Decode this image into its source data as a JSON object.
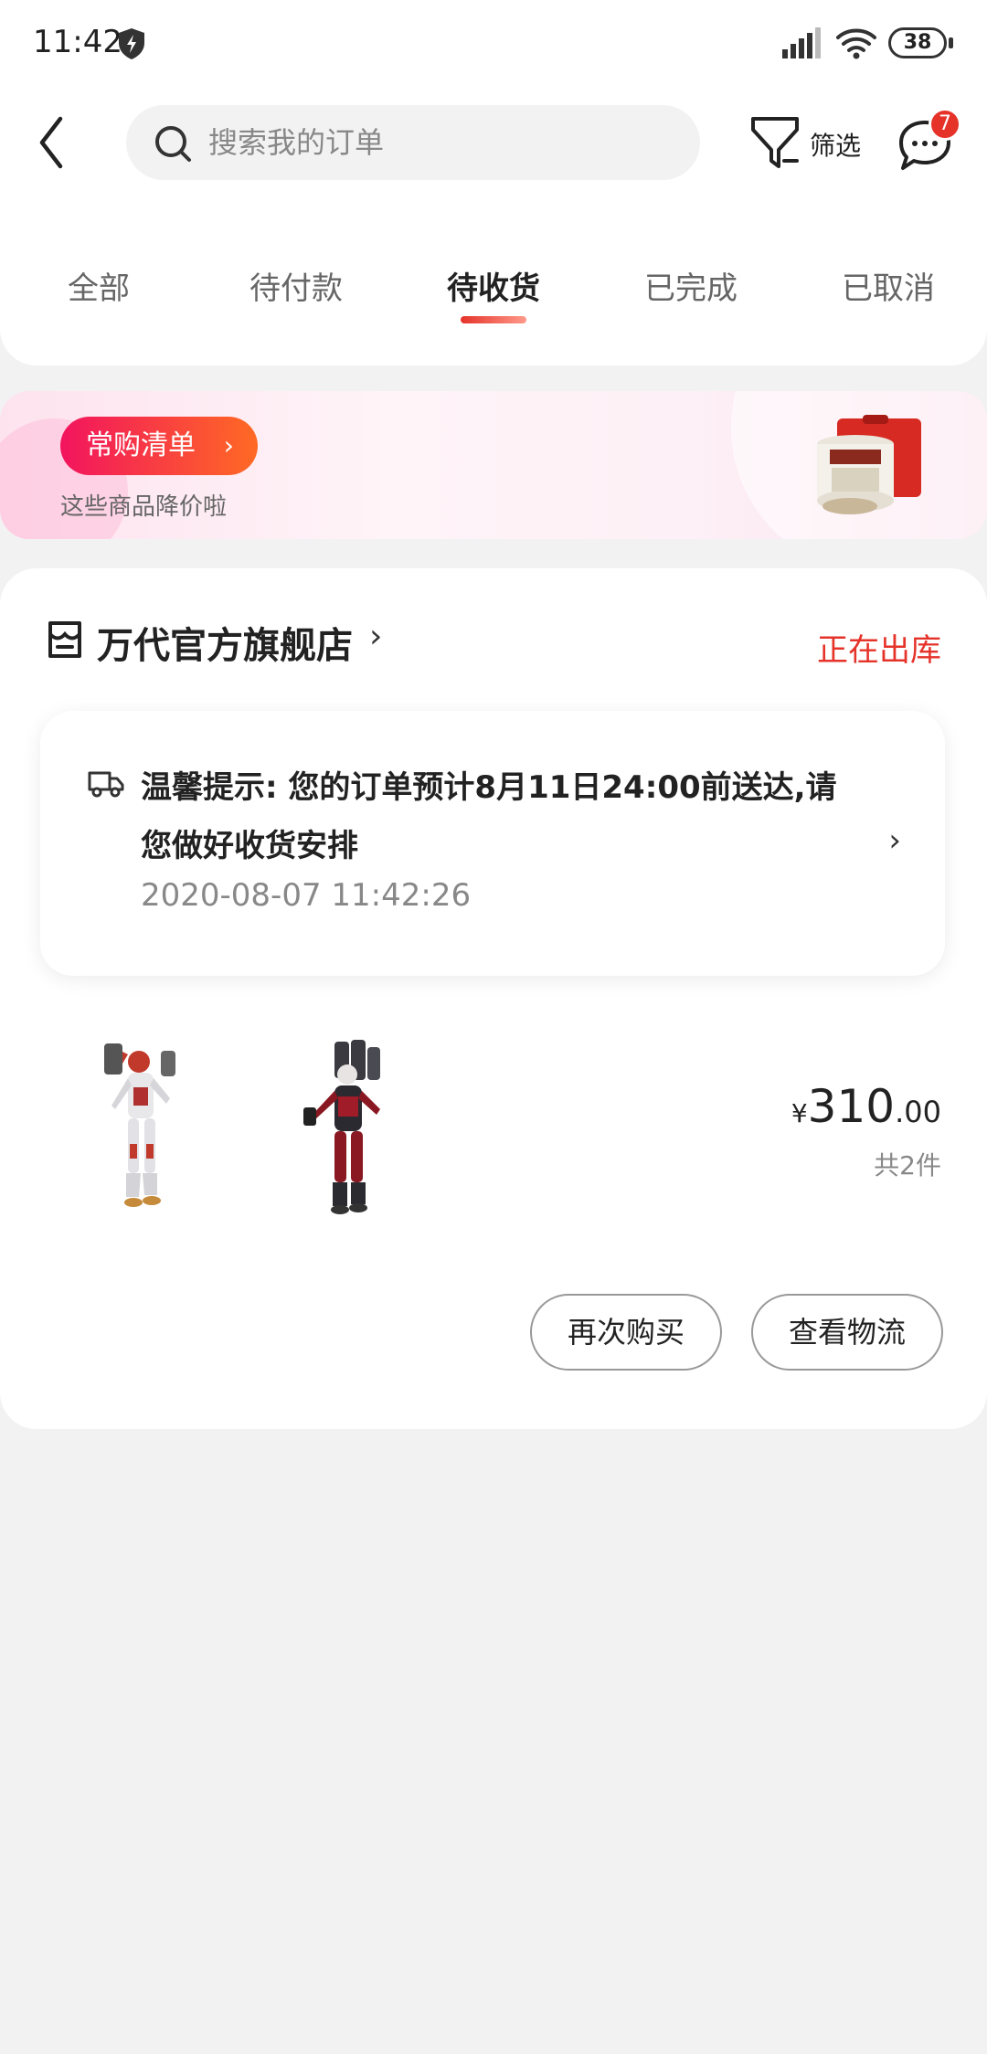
{
  "status_bar": {
    "time": "11:42",
    "battery": "38"
  },
  "header": {
    "search_placeholder": "搜索我的订单",
    "filter_label": "筛选",
    "message_badge": "7"
  },
  "tabs": [
    {
      "label": "全部"
    },
    {
      "label": "待付款"
    },
    {
      "label": "待收货",
      "active": true
    },
    {
      "label": "已完成"
    },
    {
      "label": "已取消"
    }
  ],
  "promo": {
    "title": "常购清单",
    "subtitle": "这些商品降价啦"
  },
  "order": {
    "store_name": "万代官方旗舰店",
    "status": "正在出库",
    "tip_text": "温馨提示: 您的订单预计8月11日24:00前送达,请您做好收货安排",
    "tip_time": "2020-08-07 11:42:26",
    "price_symbol": "¥",
    "price_integer": "310",
    "price_decimal": ".00",
    "item_count": "共2件",
    "buttons": {
      "buy_again": "再次购买",
      "view_logistics": "查看物流"
    }
  },
  "colors": {
    "accent": "#e5332a",
    "background": "#f2f2f2"
  }
}
